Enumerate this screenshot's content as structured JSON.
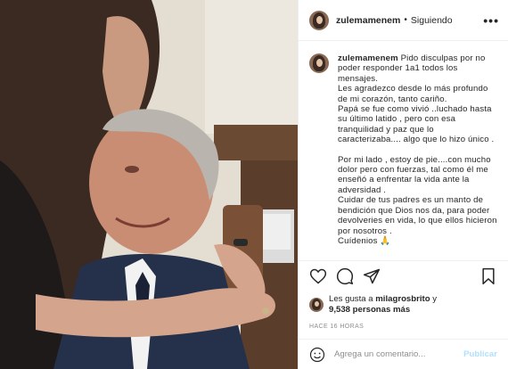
{
  "header": {
    "username": "zulemamenem",
    "separator": "•",
    "follow_status": "Siguiendo",
    "more_label": "•••"
  },
  "caption": {
    "username": "zulemamenem",
    "paragraphs": [
      "Pido disculpas por no poder responder 1a1 todos los mensajes.\nLes agradezco desde lo más profundo de mi corazón, tanto cariño.\nPapá se fue como vivió ..luchado hasta su último latido , pero con esa tranquilidad y paz que lo caracterizaba.... algo que lo hizo único .",
      "Por mi lado , estoy de pie....con mucho dolor pero con fuerzas, tal como él me enseñó a enfrentar la vida ante la adversidad .\nCuidar de tus padres es un manto de bendición que Dios nos da, para poder devolveries en vida, lo que ellos hicieron por nosotros .\nCuídenios 🙏"
    ]
  },
  "actions": {
    "like_icon": "heart-icon",
    "comment_icon": "comment-icon",
    "share_icon": "paper-plane-icon",
    "save_icon": "bookmark-icon"
  },
  "likes": {
    "prefix": "Les gusta a ",
    "user": "milagrosbrito",
    "middle": " y",
    "count": "9,538 personas más"
  },
  "timestamp": "HACE 16 HORAS",
  "comment_box": {
    "placeholder": "Agrega un comentario...",
    "publish_label": "Publicar",
    "emoji_icon": "smiley-icon"
  },
  "colors": {
    "text": "#262626",
    "muted": "#8e8e8e",
    "border": "#efefef",
    "publish_disabled": "#b2dffc"
  }
}
